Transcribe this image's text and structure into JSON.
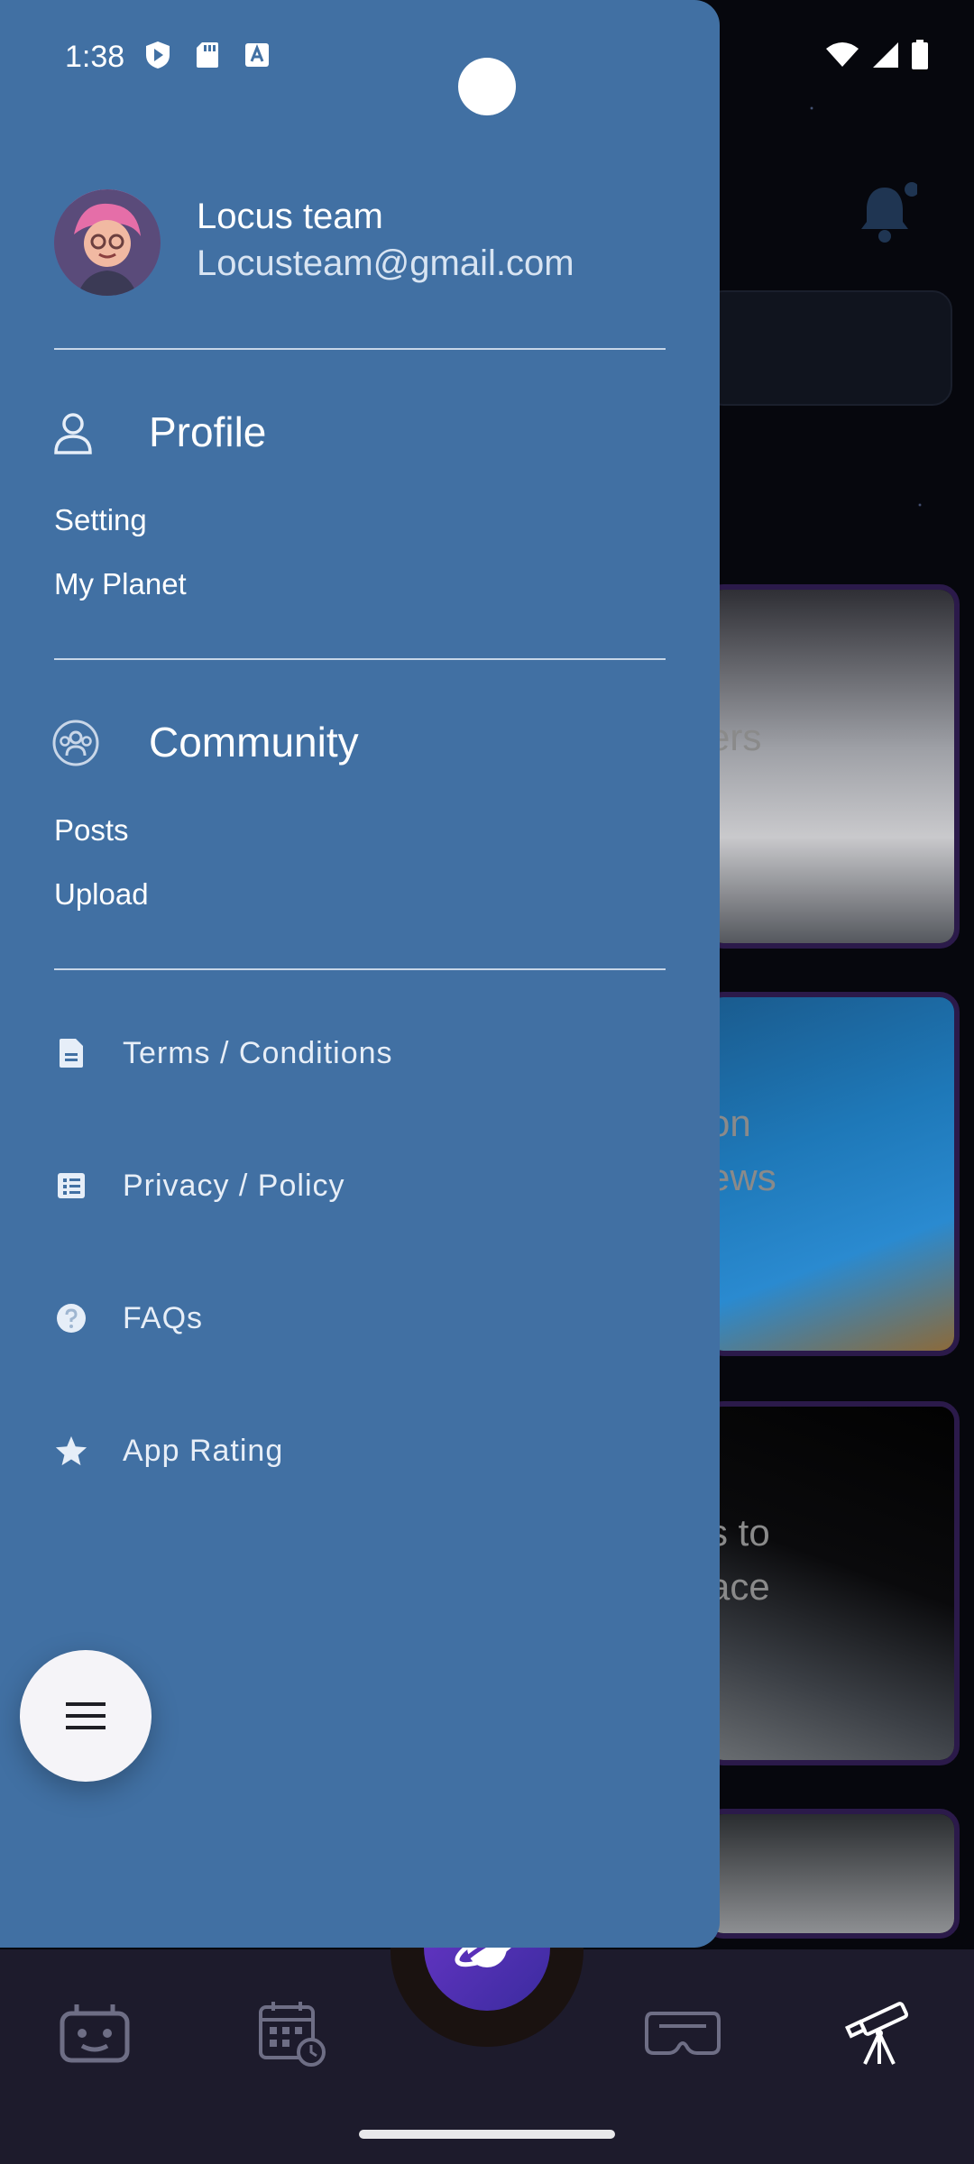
{
  "status_bar": {
    "time": "1:38"
  },
  "user": {
    "name": "Locus team",
    "email": "Locusteam@gmail.com"
  },
  "profile_section": {
    "title": "Profile",
    "items": [
      "Setting",
      "My Planet"
    ]
  },
  "community_section": {
    "title": "Community",
    "items": [
      "Posts",
      "Upload"
    ]
  },
  "menu": [
    {
      "label": "Terms / Conditions",
      "icon": "document-icon"
    },
    {
      "label": "Privacy / Policy",
      "icon": "list-document-icon"
    },
    {
      "label": "FAQs",
      "icon": "help-circle-icon"
    },
    {
      "label": "App Rating",
      "icon": "star-icon"
    }
  ],
  "background_cards": [
    {
      "text": "ers"
    },
    {
      "text": "on\news"
    },
    {
      "text": "s to\nace"
    }
  ],
  "bottom_nav": {
    "items": [
      "robot-icon",
      "calendar-clock-icon",
      "planet-icon",
      "vr-headset-icon",
      "telescope-icon"
    ]
  },
  "colors": {
    "drawer": "#4170a3",
    "nav_bg": "#1d1b2c",
    "fab_purple": "#6b36c9"
  }
}
